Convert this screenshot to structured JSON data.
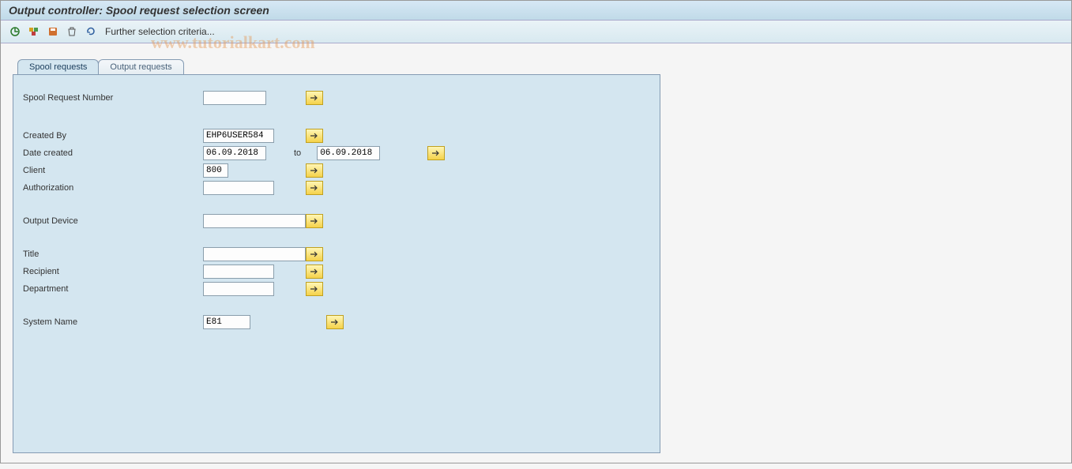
{
  "title": "Output controller: Spool request selection screen",
  "toolbar": {
    "further_criteria": "Further selection criteria..."
  },
  "watermark": "www.tutorialkart.com",
  "tabs": {
    "spool": "Spool requests",
    "output": "Output requests"
  },
  "form": {
    "spool_request_number_label": "Spool Request Number",
    "spool_request_number_value": "",
    "created_by_label": "Created By",
    "created_by_value": "EHP6USER584",
    "date_created_label": "Date created",
    "date_created_from": "06.09.2018",
    "date_to_label": "to",
    "date_created_to": "06.09.2018",
    "client_label": "Client",
    "client_value": "800",
    "authorization_label": "Authorization",
    "authorization_value": "",
    "output_device_label": "Output Device",
    "output_device_value": "",
    "title_label": "Title",
    "title_value": "",
    "recipient_label": "Recipient",
    "recipient_value": "",
    "department_label": "Department",
    "department_value": "",
    "system_name_label": "System Name",
    "system_name_value": "E81"
  }
}
